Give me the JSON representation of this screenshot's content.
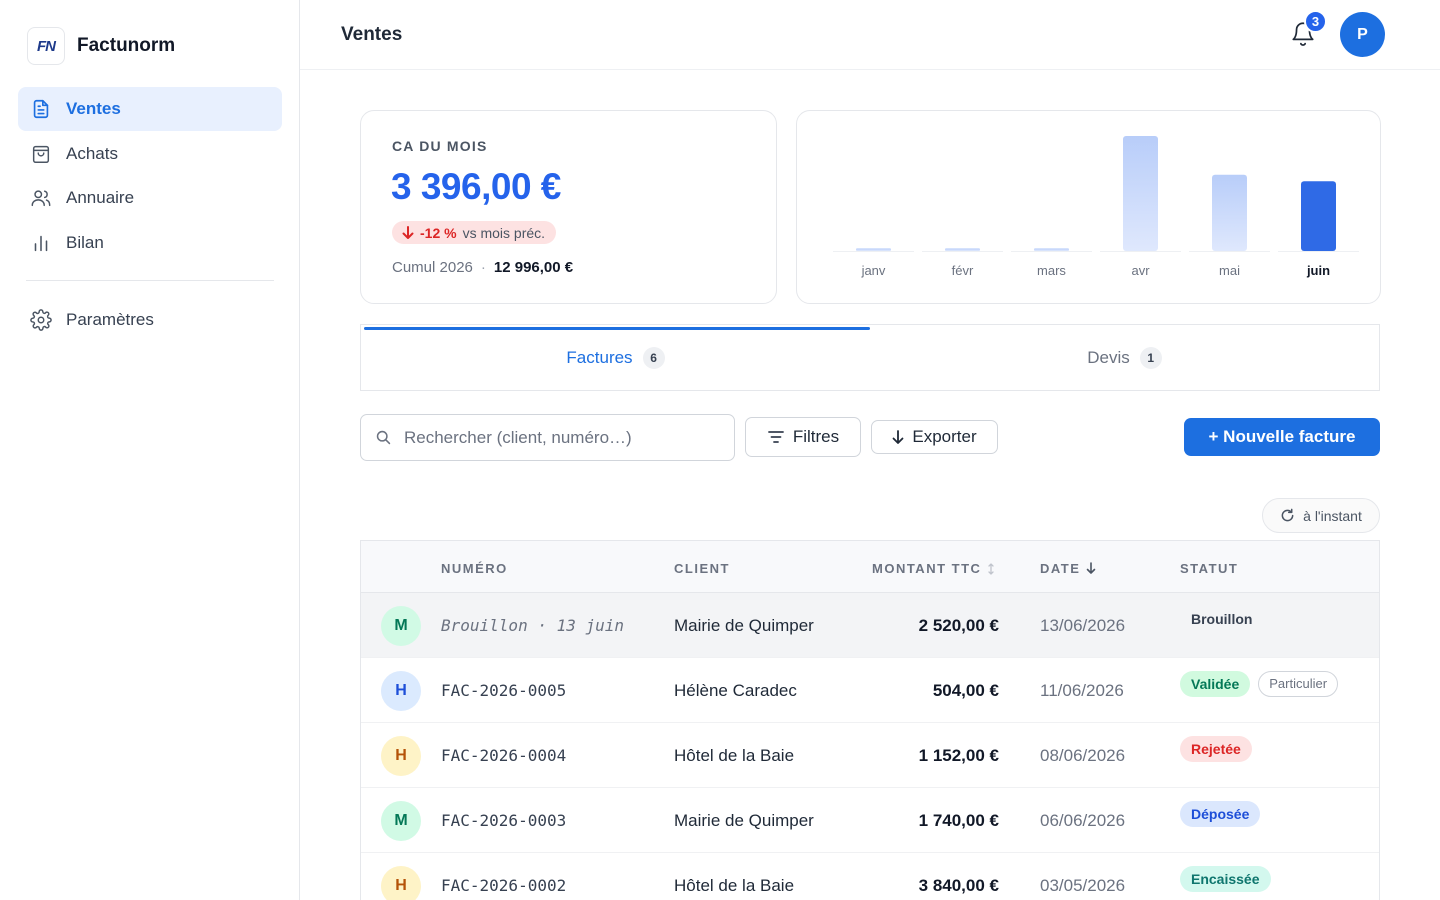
{
  "app": {
    "name": "Factunorm",
    "logo_text": "FN"
  },
  "sidebar": {
    "items": [
      {
        "label": "Ventes",
        "icon": "document-icon",
        "active": true
      },
      {
        "label": "Achats",
        "icon": "shopping-bag-icon",
        "active": false
      },
      {
        "label": "Annuaire",
        "icon": "users-icon",
        "active": false
      },
      {
        "label": "Bilan",
        "icon": "bar-chart-icon",
        "active": false
      }
    ],
    "settings": {
      "label": "Paramètres",
      "icon": "gear-icon"
    }
  },
  "header": {
    "title": "Ventes",
    "notifications_count": "3",
    "user_initial": "P"
  },
  "kpi": {
    "label": "CA DU MOIS",
    "value": "3 396,00 €",
    "delta": "-12 %",
    "delta_context": "vs mois préc.",
    "cumul_label": "Cumul 2026",
    "cumul_separator": "·",
    "cumul_value": "12 996,00 €"
  },
  "chart_data": {
    "type": "bar",
    "categories": [
      "janv",
      "févr",
      "mars",
      "avr",
      "mai",
      "juin"
    ],
    "values": [
      60,
      60,
      60,
      2640,
      1750,
      1600
    ],
    "highlighted_category": "juin",
    "colors": {
      "bar": "#c7d7fb",
      "bar_highlight": "#2f6ae6"
    }
  },
  "tabs": [
    {
      "label": "Factures",
      "count": "6",
      "active": true
    },
    {
      "label": "Devis",
      "count": "1",
      "active": false
    }
  ],
  "toolbar": {
    "search_placeholder": "Rechercher (client, numéro…)",
    "filters_label": "Filtres",
    "export_label": "Exporter",
    "new_label": "+ Nouvelle facture",
    "refresh_label": "à l'instant"
  },
  "table": {
    "columns": {
      "numero": "NUMÉRO",
      "client": "CLIENT",
      "montant": "MONTANT TTC",
      "date": "DATE",
      "statut": "STATUT"
    },
    "rows": [
      {
        "initial": "M",
        "numero": "Brouillon · 13 juin",
        "client": "Mairie de Quimper",
        "montant": "2 520,00 €",
        "date": "13/06/2026",
        "statut": "Brouillon",
        "tag": ""
      },
      {
        "initial": "H",
        "numero": "FAC-2026-0005",
        "client": "Hélène Caradec",
        "montant": "504,00 €",
        "date": "11/06/2026",
        "statut": "Validée",
        "tag": "Particulier"
      },
      {
        "initial": "H",
        "numero": "FAC-2026-0004",
        "client": "Hôtel de la Baie",
        "montant": "1 152,00 €",
        "date": "08/06/2026",
        "statut": "Rejetée",
        "tag": ""
      },
      {
        "initial": "M",
        "numero": "FAC-2026-0003",
        "client": "Mairie de Quimper",
        "montant": "1 740,00 €",
        "date": "06/06/2026",
        "statut": "Déposée",
        "tag": ""
      },
      {
        "initial": "H",
        "numero": "FAC-2026-0002",
        "client": "Hôtel de la Baie",
        "montant": "3 840,00 €",
        "date": "03/05/2026",
        "statut": "Encaissée",
        "tag": ""
      }
    ]
  },
  "colors": {
    "accent": "#1d6fe0",
    "status_validee": "#d1fadf",
    "status_rejetee": "#fde2e2",
    "status_deposee": "#dbe7fd",
    "status_encaissee": "#d3f8ee"
  }
}
